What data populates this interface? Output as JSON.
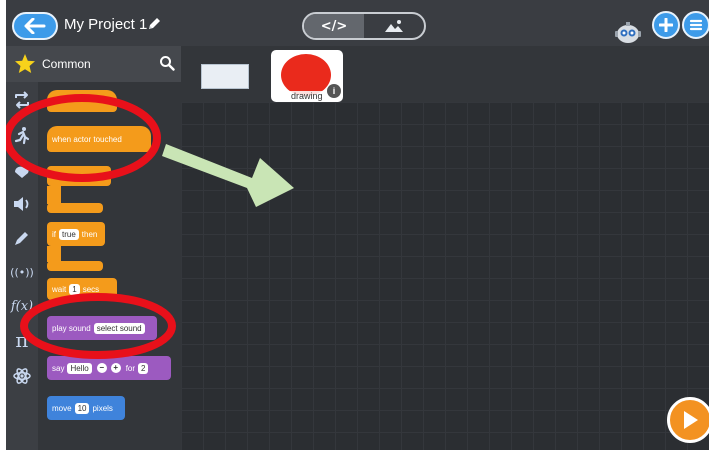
{
  "header": {
    "project_title": "My Project 1",
    "view_toggle": {
      "code_label": "</>",
      "stage_label": "scene-icon"
    }
  },
  "palette": {
    "category_title": "Common",
    "categories": [
      {
        "name": "control",
        "icon": "loop-icon"
      },
      {
        "name": "motion",
        "icon": "running-person-icon"
      },
      {
        "name": "looks",
        "icon": "looks-icon"
      },
      {
        "name": "sound",
        "icon": "speaker-icon"
      },
      {
        "name": "pen",
        "icon": "pen-icon"
      },
      {
        "name": "sensing",
        "glyph": "((•))"
      },
      {
        "name": "functions",
        "glyph": "f(x)"
      },
      {
        "name": "math",
        "glyph": "π"
      },
      {
        "name": "science",
        "icon": "atom-icon"
      }
    ],
    "blocks": {
      "when_actor_touched": "when actor touched",
      "if_label": "if",
      "if_value": "true",
      "if_then": "then",
      "wait_label": "wait",
      "wait_value": "1",
      "wait_unit": "secs",
      "play_sound_label": "play sound",
      "play_sound_value": "select sound",
      "say_label": "say",
      "say_value": "Hello",
      "say_minus": "−",
      "say_plus": "+",
      "say_for": "for",
      "say_duration": "2",
      "move_label": "move",
      "move_value": "10",
      "move_unit": "pixels"
    }
  },
  "stage": {
    "actor_name": "drawing",
    "actor_color": "#ea2a1c",
    "info_glyph": "i"
  },
  "colors": {
    "accent_blue": "#3d9be9",
    "block_orange": "#f49b1b",
    "block_purple": "#9c5ac0",
    "block_blue": "#3f83db",
    "annotation_red": "#e8101a",
    "annotation_arrow": "#c9e5b5",
    "play_orange": "#f39221"
  }
}
